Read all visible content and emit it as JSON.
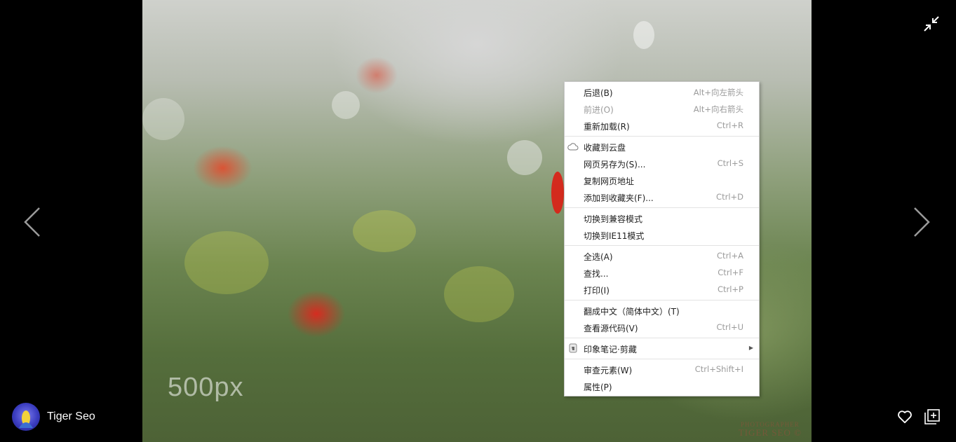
{
  "author": {
    "name": "Tiger Seo"
  },
  "photo": {
    "watermark_500px": "500px",
    "photographer_line1": "PHOTOGRAPHER",
    "photographer_line2": "TIGER SEO ©"
  },
  "icons": {
    "prev": "chevron-left-icon",
    "next": "chevron-right-icon",
    "collapse": "collapse-arrows-icon",
    "like": "heart-icon",
    "add": "add-to-collection-icon",
    "cloud": "cloud-icon",
    "evernote": "evernote-icon",
    "submenu": "submenu-arrow-icon"
  },
  "colors": {
    "background": "#000000",
    "menu_bg": "#ffffff",
    "shortcut_text": "#9b9b9b"
  },
  "context_menu": {
    "items": [
      {
        "label": "后退(B)",
        "shortcut": "Alt+向左箭头",
        "enabled": true
      },
      {
        "label": "前进(O)",
        "shortcut": "Alt+向右箭头",
        "enabled": false
      },
      {
        "label": "重新加载(R)",
        "shortcut": "Ctrl+R",
        "enabled": true
      },
      {
        "label": "收藏到云盘",
        "shortcut": "",
        "enabled": true
      },
      {
        "label": "网页另存为(S)...",
        "shortcut": "Ctrl+S",
        "enabled": true
      },
      {
        "label": "复制网页地址",
        "shortcut": "",
        "enabled": true
      },
      {
        "label": "添加到收藏夹(F)...",
        "shortcut": "Ctrl+D",
        "enabled": true
      },
      {
        "label": "切换到兼容模式",
        "shortcut": "",
        "enabled": true
      },
      {
        "label": "切换到IE11模式",
        "shortcut": "",
        "enabled": true
      },
      {
        "label": "全选(A)",
        "shortcut": "Ctrl+A",
        "enabled": true
      },
      {
        "label": "查找...",
        "shortcut": "Ctrl+F",
        "enabled": true
      },
      {
        "label": "打印(I)",
        "shortcut": "Ctrl+P",
        "enabled": true
      },
      {
        "label": "翻成中文（简体中文）(T)",
        "shortcut": "",
        "enabled": true
      },
      {
        "label": "查看源代码(V)",
        "shortcut": "Ctrl+U",
        "enabled": true
      },
      {
        "label": "印象笔记·剪藏",
        "shortcut": "",
        "enabled": true,
        "submenu": true
      },
      {
        "label": "审查元素(W)",
        "shortcut": "Ctrl+Shift+I",
        "enabled": true
      },
      {
        "label": "属性(P)",
        "shortcut": "",
        "enabled": true
      }
    ]
  }
}
